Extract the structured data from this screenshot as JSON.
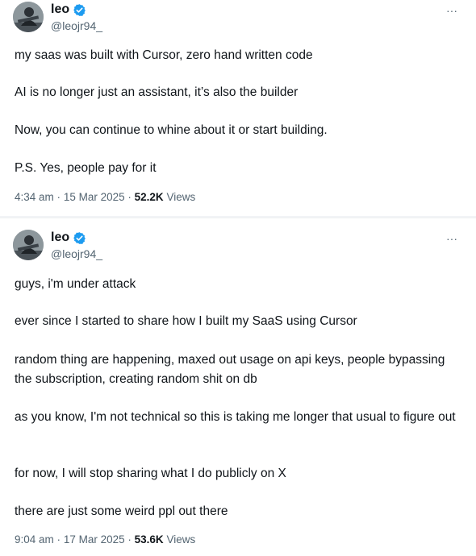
{
  "tweets": [
    {
      "author_name": "leo",
      "author_handle": "@leojr94_",
      "more_label": "···",
      "paragraphs": [
        "my saas was built with Cursor, zero hand written code",
        "AI is no longer just an assistant, it’s also the builder",
        "Now, you can continue to whine about it or start building.",
        "P.S. Yes, people pay for it"
      ],
      "time": "4:34 am",
      "date": "15 Mar 2025",
      "separator": "·",
      "views_count": "52.2K",
      "views_label": "Views"
    },
    {
      "author_name": "leo",
      "author_handle": "@leojr94_",
      "more_label": "···",
      "paragraphs": [
        "guys, i'm under attack",
        "ever since I started to share how I built my SaaS using Cursor",
        "random thing are happening, maxed out usage on api keys, people bypassing the subscription, creating random shit on db",
        "as you know, I'm not technical so this is taking me longer that usual to figure out",
        "for now, I will stop sharing what I do publicly on X",
        "there are just some weird ppl out there"
      ],
      "time": "9:04 am",
      "date": "17 Mar 2025",
      "separator": "·",
      "views_count": "53.6K",
      "views_label": "Views"
    }
  ],
  "colors": {
    "text": "#0f1419",
    "secondary": "#536471",
    "verified": "#1d9bf0"
  },
  "icons": {
    "verified": "verified-badge-icon",
    "more": "more-options-icon"
  }
}
